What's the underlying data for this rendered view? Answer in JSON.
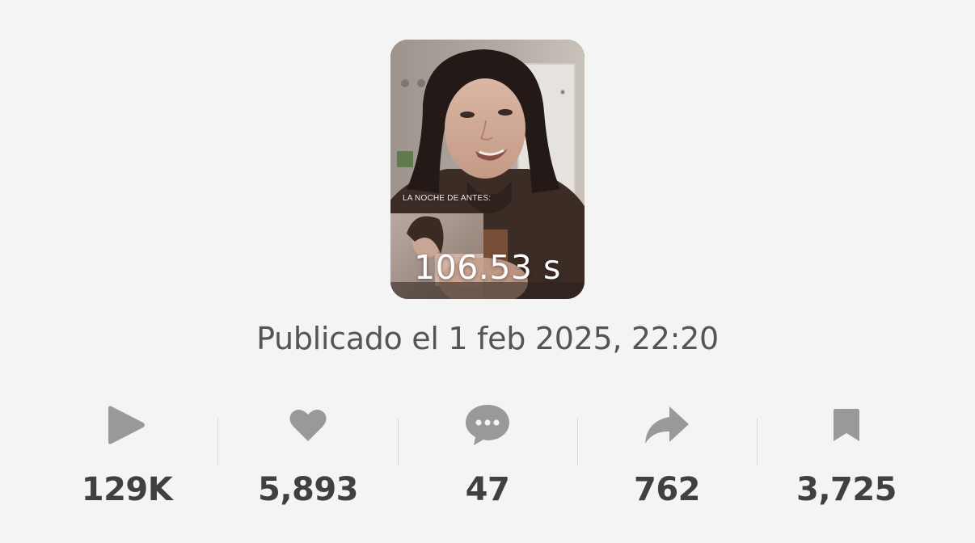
{
  "video": {
    "overlay_caption": "LA NOCHE DE ANTES:",
    "duration": "106.53 s"
  },
  "published": "Publicado el 1 feb 2025, 22:20",
  "stats": {
    "plays": "129K",
    "likes": "5,893",
    "comments": "47",
    "shares": "762",
    "saves": "3,725"
  },
  "colors": {
    "background": "#f5f4f4",
    "icon": "#999999",
    "count_text": "#404040",
    "published_text": "#555555"
  },
  "icons": [
    "play-icon",
    "heart-icon",
    "comment-icon",
    "share-icon",
    "bookmark-icon"
  ]
}
